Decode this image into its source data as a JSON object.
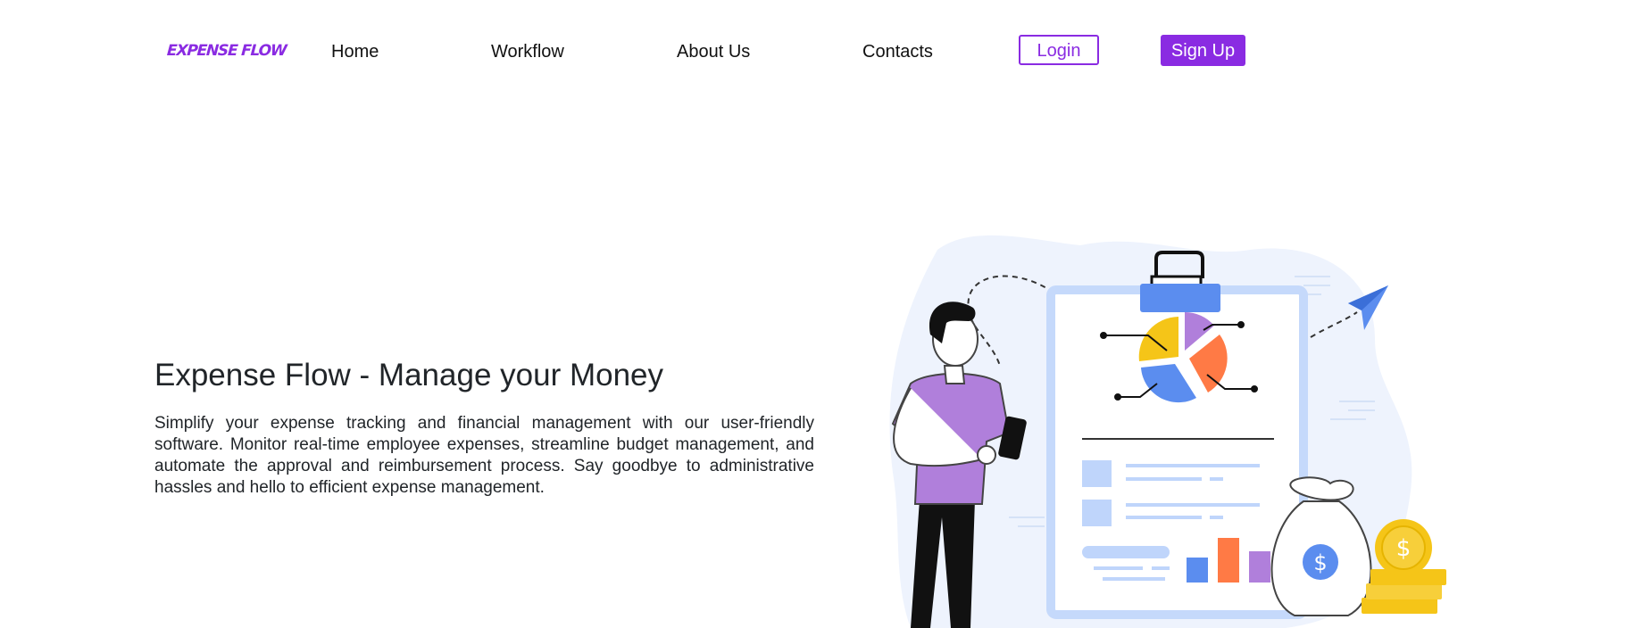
{
  "brand": {
    "logo_text": "EXPENSE FLOW",
    "color": "#8a2be2"
  },
  "nav": {
    "items": [
      {
        "label": "Home"
      },
      {
        "label": "Workflow"
      },
      {
        "label": "About Us"
      },
      {
        "label": "Contacts"
      }
    ],
    "login_label": "Login",
    "signup_label": "Sign Up"
  },
  "hero": {
    "title": "Expense Flow - Manage your Money",
    "description": "Simplify your expense tracking and financial management with our user-friendly software. Monitor real-time employee expenses, streamline budget management, and automate the approval and reimbursement process. Say goodbye to administrative hassles and hello to efficient expense management."
  },
  "illustration": {
    "money_symbol": "$",
    "colors": {
      "blob": "#eef3fd",
      "clipboard_border": "#c5d9fb",
      "blue": "#5b8def",
      "purple": "#b07fdb",
      "orange": "#ff7a45",
      "yellow": "#f5c518",
      "dark": "#111111"
    }
  }
}
